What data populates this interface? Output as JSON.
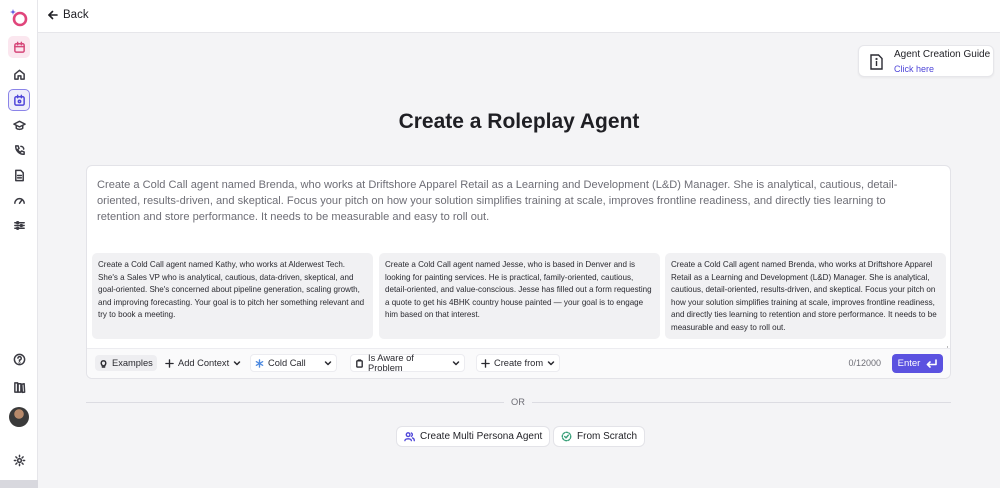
{
  "topbar": {
    "back_label": "Back"
  },
  "guide": {
    "title": "Agent Creation Guide",
    "link": "Click here"
  },
  "page": {
    "title": "Create a Roleplay Agent"
  },
  "composer": {
    "prompt_placeholder": "Create a Cold Call agent named Brenda, who works at Driftshore Apparel Retail as a Learning and Development (L&D) Manager. She is analytical, cautious, detail-oriented, results-driven, and skeptical. Focus your pitch on how your solution simplifies training at scale, improves frontline readiness, and directly ties learning to retention and store performance. It needs to be measurable and easy to roll out.",
    "examples": [
      "Create a Cold Call agent named Kathy, who works at Alderwest Tech. She's a Sales VP who is analytical, cautious, data-driven, skeptical, and goal-oriented. She's concerned about pipeline generation, scaling growth, and improving forecasting. Your goal is to pitch her something relevant and try to book a meeting.",
      "Create a Cold Call agent named Jesse, who is based in Denver and is looking for painting services. He is practical, family-oriented, cautious, detail-oriented, and value-conscious. Jesse has filled out a form requesting a quote to get his 4BHK country house painted — your goal is to engage him based on that interest.",
      "Create a Cold Call agent named Brenda, who works at Driftshore Apparel Retail as a Learning and Development (L&D) Manager. She is analytical, cautious, detail-oriented, results-driven, and skeptical. Focus your pitch on how your solution simplifies training at scale, improves frontline readiness, and directly ties learning to retention and store performance. It needs to be measurable and easy to roll out."
    ],
    "toolbar": {
      "examples_label": "Examples",
      "add_context_label": "Add Context",
      "call_type_value": "Cold Call",
      "awareness_value": "Is Aware of Problem",
      "create_from_label": "Create from",
      "counter": "0/12000",
      "enter_label": "Enter"
    }
  },
  "divider": {
    "or_label": "OR"
  },
  "actions": {
    "multi_persona_label": "Create Multi Persona Agent",
    "scratch_label": "From Scratch"
  },
  "colors": {
    "accent": "#5b52e0",
    "logo_pink": "#e0457b"
  }
}
